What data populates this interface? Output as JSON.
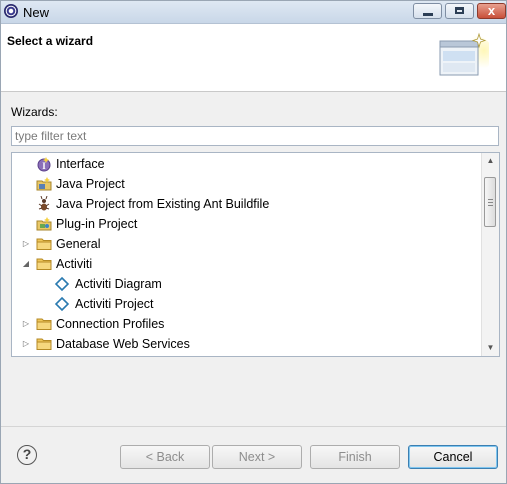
{
  "window": {
    "title": "New",
    "close_glyph": "x"
  },
  "header": {
    "title": "Select a wizard"
  },
  "wizards": {
    "label": "Wizards:",
    "filter_placeholder": "type filter text",
    "filter_value": ""
  },
  "tree": {
    "items": [
      {
        "label": "Interface",
        "icon": "interface-icon",
        "level": 1,
        "expander": ""
      },
      {
        "label": "Java Project",
        "icon": "java-project-icon",
        "level": 1,
        "expander": ""
      },
      {
        "label": "Java Project from Existing Ant Buildfile",
        "icon": "ant-icon",
        "level": 1,
        "expander": ""
      },
      {
        "label": "Plug-in Project",
        "icon": "plugin-project-icon",
        "level": 1,
        "expander": ""
      },
      {
        "label": "General",
        "icon": "folder-icon",
        "level": 0,
        "expander": "▷"
      },
      {
        "label": "Activiti",
        "icon": "folder-icon",
        "level": 0,
        "expander": "◢"
      },
      {
        "label": "Activiti Diagram",
        "icon": "activiti-diamond-icon",
        "level": 2,
        "expander": ""
      },
      {
        "label": "Activiti Project",
        "icon": "activiti-diamond-icon",
        "level": 2,
        "expander": ""
      },
      {
        "label": "Connection Profiles",
        "icon": "folder-icon",
        "level": 0,
        "expander": "▷"
      },
      {
        "label": "Database Web Services",
        "icon": "folder-icon",
        "level": 0,
        "expander": "▷"
      }
    ]
  },
  "scrollbar": {
    "up_glyph": "▲",
    "down_glyph": "▼"
  },
  "buttons": {
    "help": "?",
    "back": "< Back",
    "next": "Next >",
    "finish": "Finish",
    "cancel": "Cancel"
  }
}
